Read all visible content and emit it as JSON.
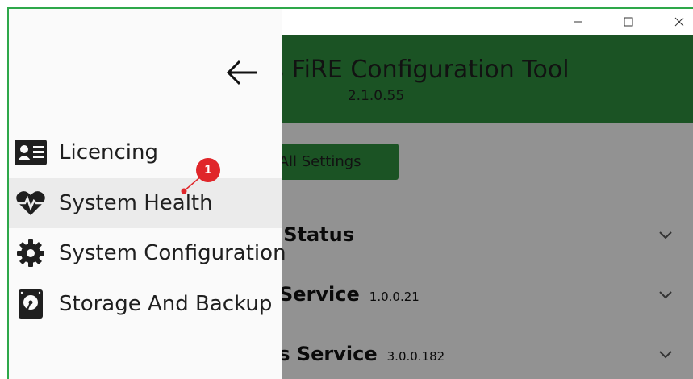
{
  "app": {
    "title": "FiRE Configuration Tool",
    "title_visible_fragment": "s FiRE Configuration Tool",
    "version": "2.1.0.55"
  },
  "toolbar": {
    "reset_button_label": "set All Settings"
  },
  "sections": [
    {
      "title": "r Status",
      "version": ""
    },
    {
      "title": "Service",
      "version": "1.0.0.21"
    },
    {
      "title": "cs Service",
      "version": "3.0.0.182"
    }
  ],
  "drawer": {
    "back_icon": "arrow-left-icon",
    "items": [
      {
        "label": "Licencing",
        "icon": "id-card-icon",
        "active": false
      },
      {
        "label": "System Health",
        "icon": "heartbeat-icon",
        "active": true
      },
      {
        "label": "System Configuration",
        "icon": "gear-icon",
        "active": false
      },
      {
        "label": "Storage And Backup",
        "icon": "hard-drive-icon",
        "active": false
      }
    ]
  },
  "annotation": {
    "badge_number": "1"
  },
  "colors": {
    "accent_green": "#2e8b3c",
    "window_border": "#2ea84a",
    "marker_red": "#e0262a"
  }
}
